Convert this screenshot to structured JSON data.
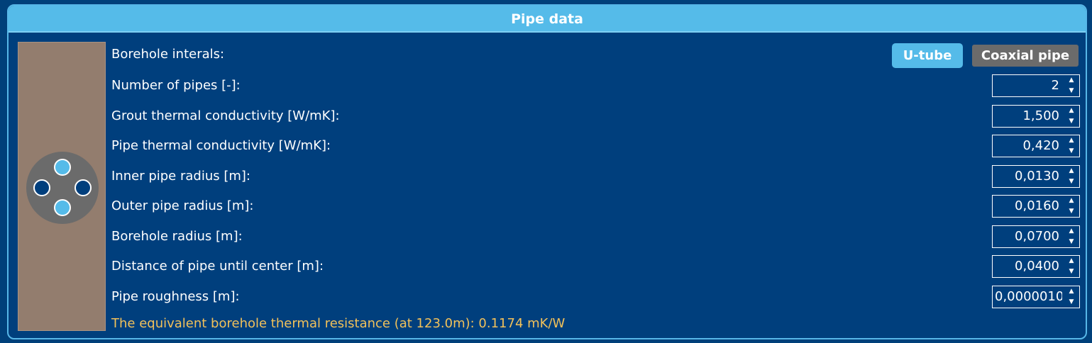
{
  "panel": {
    "title": "Pipe data"
  },
  "borehole_internals": {
    "label": "Borehole interals:",
    "options": [
      "U-tube",
      "Coaxial pipe"
    ],
    "selected": "U-tube"
  },
  "fields": [
    {
      "label": "Number of pipes [-]:",
      "value": "2"
    },
    {
      "label": "Grout thermal conductivity [W/mK]:",
      "value": "1,500"
    },
    {
      "label": "Pipe thermal conductivity [W/mK]:",
      "value": "0,420"
    },
    {
      "label": "Inner pipe radius [m]:",
      "value": "0,0130"
    },
    {
      "label": "Outer pipe radius [m]:",
      "value": "0,0160"
    },
    {
      "label": "Borehole radius [m]:",
      "value": "0,0700"
    },
    {
      "label": "Distance of pipe until center [m]:",
      "value": "0,0400"
    },
    {
      "label": "Pipe roughness [m]:",
      "value": "0,0000010"
    }
  ],
  "result_text": "The equivalent borehole thermal resistance (at 123.0m): 0.1174 mK/W",
  "spinner_arrows": {
    "up": "▲",
    "down": "▼"
  },
  "colors": {
    "background": "#003f7d",
    "header": "#55bbe9",
    "soil": "#937d6e",
    "grout": "#6b6b6b",
    "pipe_supply": "#55bbe9",
    "pipe_return": "#003f7d",
    "result_text": "#f2c15a"
  },
  "icons": {
    "borehole_diagram": "borehole-cross-section-icon"
  }
}
